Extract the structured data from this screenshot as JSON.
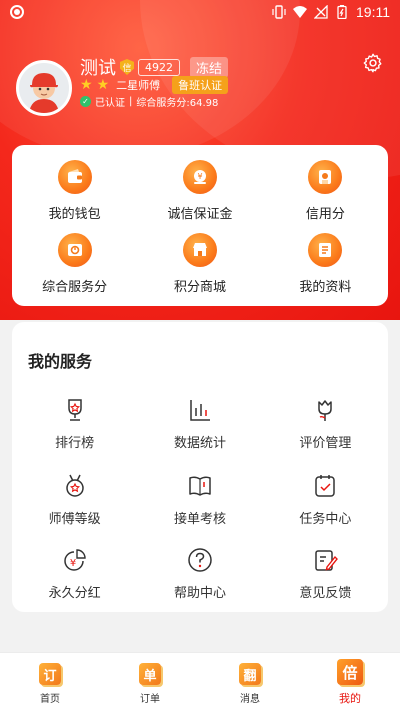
{
  "status_bar": {
    "time": "19:11"
  },
  "profile": {
    "name": "测试",
    "shield_badge": "信",
    "score": "4922",
    "freeze_label": "冻结",
    "star_count": 2,
    "level": "二星师傅",
    "luban_label": "鲁班认证",
    "certified_label": "已认证",
    "service_score_label": "综合服务分:64.98"
  },
  "wallet_grid": [
    {
      "label": "我的钱包",
      "icon": "wallet-icon"
    },
    {
      "label": "诚信保证金",
      "icon": "deposit-icon"
    },
    {
      "label": "信用分",
      "icon": "credit-icon"
    },
    {
      "label": "综合服务分",
      "icon": "service-score-icon"
    },
    {
      "label": "积分商城",
      "icon": "points-mall-icon"
    },
    {
      "label": "我的资料",
      "icon": "profile-doc-icon"
    }
  ],
  "services": {
    "title": "我的服务",
    "items": [
      {
        "label": "排行榜",
        "icon": "trophy-icon"
      },
      {
        "label": "数据统计",
        "icon": "bar-chart-icon"
      },
      {
        "label": "评价管理",
        "icon": "tulip-icon"
      },
      {
        "label": "师傅等级",
        "icon": "medal-icon"
      },
      {
        "label": "接单考核",
        "icon": "open-book-icon"
      },
      {
        "label": "任务中心",
        "icon": "task-check-icon"
      },
      {
        "label": "永久分红",
        "icon": "yuan-pie-icon"
      },
      {
        "label": "帮助中心",
        "icon": "question-icon"
      },
      {
        "label": "意见反馈",
        "icon": "feedback-edit-icon"
      }
    ]
  },
  "tabbar": [
    {
      "label": "首页",
      "glyph": "订",
      "active": false
    },
    {
      "label": "订单",
      "glyph": "单",
      "active": false
    },
    {
      "label": "消息",
      "glyph": "翻",
      "active": false
    },
    {
      "label": "我的",
      "glyph": "倍",
      "active": true
    }
  ],
  "colors": {
    "brand_red": "#e8150f",
    "accent_orange": "#f5a11b",
    "star_yellow": "#ffcf24",
    "certified_green": "#2fc26b"
  }
}
